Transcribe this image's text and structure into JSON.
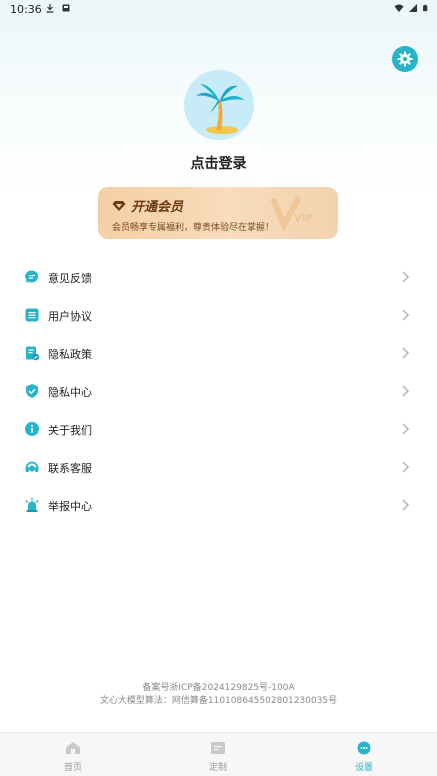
{
  "status_bar": {
    "time": "10:36",
    "left_icons": [
      "download-icon",
      "notification-icon"
    ],
    "right_icons": [
      "wifi-icon",
      "signal-icon",
      "battery-icon"
    ]
  },
  "header": {
    "settings_icon": "gear-icon",
    "accent_color": "#27b4c9"
  },
  "profile": {
    "avatar": "palm-tree-avatar",
    "login_label": "点击登录"
  },
  "vip_card": {
    "title": "开通会员",
    "subtitle": "会员畅享专属福利，尊贵体验尽在掌握！",
    "watermark": "VIP"
  },
  "menu": {
    "items": [
      {
        "label": "意见反馈",
        "icon": "feedback-icon"
      },
      {
        "label": "用户协议",
        "icon": "agreement-icon"
      },
      {
        "label": "隐私政策",
        "icon": "privacy-policy-icon"
      },
      {
        "label": "隐私中心",
        "icon": "shield-check-icon"
      },
      {
        "label": "关于我们",
        "icon": "info-icon"
      },
      {
        "label": "联系客服",
        "icon": "headset-icon"
      },
      {
        "label": "举报中心",
        "icon": "alarm-icon"
      }
    ]
  },
  "footer": {
    "icp": "备案号浙ICP备2024129825号-100A",
    "algorithm": "文心大模型算法：网信算备110108645502801230035号"
  },
  "bottom_nav": {
    "tabs": [
      {
        "label": "首页",
        "icon": "home-icon",
        "active": false
      },
      {
        "label": "定制",
        "icon": "customize-icon",
        "active": false
      },
      {
        "label": "设置",
        "icon": "settings-tab-icon",
        "active": true
      }
    ]
  }
}
